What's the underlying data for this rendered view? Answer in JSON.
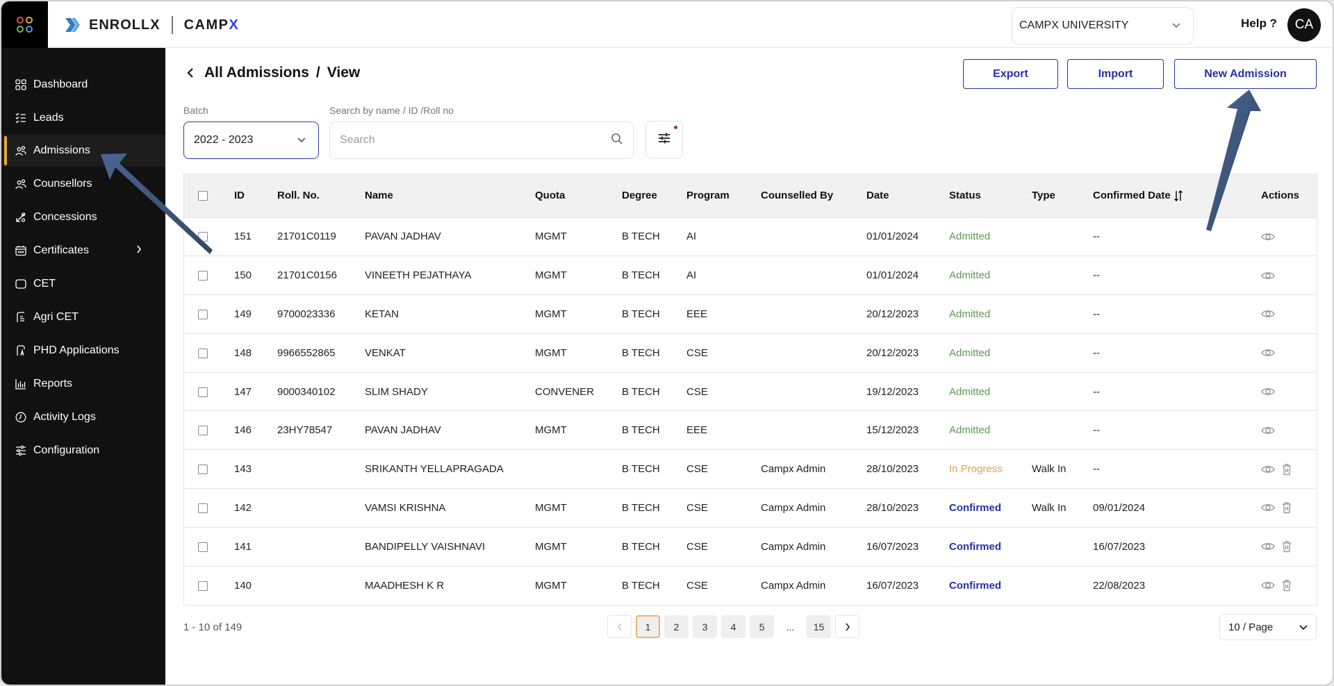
{
  "topbar": {
    "brand_name": "ENROLLX",
    "brand_partner_prefix": "CAMP",
    "brand_partner_suffix": "X",
    "org_selector": "CAMPX UNIVERSITY",
    "help_label": "Help ?",
    "avatar_initials": "CA"
  },
  "sidebar": {
    "items": [
      {
        "label": "Dashboard",
        "icon": "dashboard-icon"
      },
      {
        "label": "Leads",
        "icon": "checklist-icon"
      },
      {
        "label": "Admissions",
        "icon": "users-icon",
        "active": true
      },
      {
        "label": "Counsellors",
        "icon": "users-icon"
      },
      {
        "label": "Concessions",
        "icon": "percent-icon"
      },
      {
        "label": "Certificates",
        "icon": "calendar-icon",
        "has_submenu": true
      },
      {
        "label": "CET",
        "icon": "square-icon"
      },
      {
        "label": "Agri CET",
        "icon": "document-icon"
      },
      {
        "label": "PHD Applications",
        "icon": "document-a-icon"
      },
      {
        "label": "Reports",
        "icon": "bar-chart-icon"
      },
      {
        "label": "Activity Logs",
        "icon": "clock-icon"
      },
      {
        "label": "Configuration",
        "icon": "sliders-icon"
      }
    ]
  },
  "header": {
    "breadcrumb_root": "All Admissions",
    "breadcrumb_separator": "/",
    "breadcrumb_current": "View",
    "export_label": "Export",
    "import_label": "Import",
    "new_admission_label": "New Admission"
  },
  "filters": {
    "batch_label": "Batch",
    "batch_value": "2022 - 2023",
    "search_label": "Search by name / ID /Roll no",
    "search_placeholder": "Search",
    "search_value": ""
  },
  "table": {
    "columns": [
      "ID",
      "Roll. No.",
      "Name",
      "Quota",
      "Degree",
      "Program",
      "Counselled By",
      "Date",
      "Status",
      "Type",
      "Confirmed Date",
      "Actions"
    ],
    "rows": [
      {
        "id": "151",
        "roll": "21701C0119",
        "name": "PAVAN JADHAV",
        "quota": "MGMT",
        "degree": "B TECH",
        "program": "AI",
        "counselled_by": "",
        "date": "01/01/2024",
        "status": "Admitted",
        "type": "",
        "confirmed_date": "--",
        "deletable": false
      },
      {
        "id": "150",
        "roll": "21701C0156",
        "name": "VINEETH PEJATHAYA",
        "quota": "MGMT",
        "degree": "B TECH",
        "program": "AI",
        "counselled_by": "",
        "date": "01/01/2024",
        "status": "Admitted",
        "type": "",
        "confirmed_date": "--",
        "deletable": false
      },
      {
        "id": "149",
        "roll": "9700023336",
        "name": "KETAN",
        "quota": "MGMT",
        "degree": "B TECH",
        "program": "EEE",
        "counselled_by": "",
        "date": "20/12/2023",
        "status": "Admitted",
        "type": "",
        "confirmed_date": "--",
        "deletable": false
      },
      {
        "id": "148",
        "roll": "9966552865",
        "name": "VENKAT",
        "quota": "MGMT",
        "degree": "B TECH",
        "program": "CSE",
        "counselled_by": "",
        "date": "20/12/2023",
        "status": "Admitted",
        "type": "",
        "confirmed_date": "--",
        "deletable": false
      },
      {
        "id": "147",
        "roll": "9000340102",
        "name": "SLIM SHADY",
        "quota": "CONVENER",
        "degree": "B TECH",
        "program": "CSE",
        "counselled_by": "",
        "date": "19/12/2023",
        "status": "Admitted",
        "type": "",
        "confirmed_date": "--",
        "deletable": false
      },
      {
        "id": "146",
        "roll": "23HY78547",
        "name": "PAVAN JADHAV",
        "quota": "MGMT",
        "degree": "B TECH",
        "program": "EEE",
        "counselled_by": "",
        "date": "15/12/2023",
        "status": "Admitted",
        "type": "",
        "confirmed_date": "--",
        "deletable": false
      },
      {
        "id": "143",
        "roll": "",
        "name": "SRIKANTH YELLAPRAGADA",
        "quota": "",
        "degree": "B TECH",
        "program": "CSE",
        "counselled_by": "Campx Admin",
        "date": "28/10/2023",
        "status": "In Progress",
        "type": "Walk In",
        "confirmed_date": "--",
        "deletable": true
      },
      {
        "id": "142",
        "roll": "",
        "name": "VAMSI KRISHNA",
        "quota": "MGMT",
        "degree": "B TECH",
        "program": "CSE",
        "counselled_by": "Campx Admin",
        "date": "28/10/2023",
        "status": "Confirmed",
        "type": "Walk In",
        "confirmed_date": "09/01/2024",
        "deletable": true
      },
      {
        "id": "141",
        "roll": "",
        "name": "BANDIPELLY VAISHNAVI",
        "quota": "MGMT",
        "degree": "B TECH",
        "program": "CSE",
        "counselled_by": "Campx Admin",
        "date": "16/07/2023",
        "status": "Confirmed",
        "type": "",
        "confirmed_date": "16/07/2023",
        "deletable": true
      },
      {
        "id": "140",
        "roll": "",
        "name": "MAADHESH K R",
        "quota": "MGMT",
        "degree": "B TECH",
        "program": "CSE",
        "counselled_by": "Campx Admin",
        "date": "16/07/2023",
        "status": "Confirmed",
        "type": "",
        "confirmed_date": "22/08/2023",
        "deletable": true
      }
    ]
  },
  "pagination": {
    "range_text": "1 - 10 of 149",
    "pages": [
      "1",
      "2",
      "3",
      "4",
      "5",
      "...",
      "15"
    ],
    "current_page": "1",
    "page_size": "10 / Page"
  },
  "colors": {
    "accent": "#2431a8",
    "active_indicator": "#e9a93b",
    "status_admitted": "#5c9a4e",
    "status_in_progress": "#e0a050",
    "status_confirmed": "#2431a8",
    "annotation_arrow": "#3d5478"
  }
}
